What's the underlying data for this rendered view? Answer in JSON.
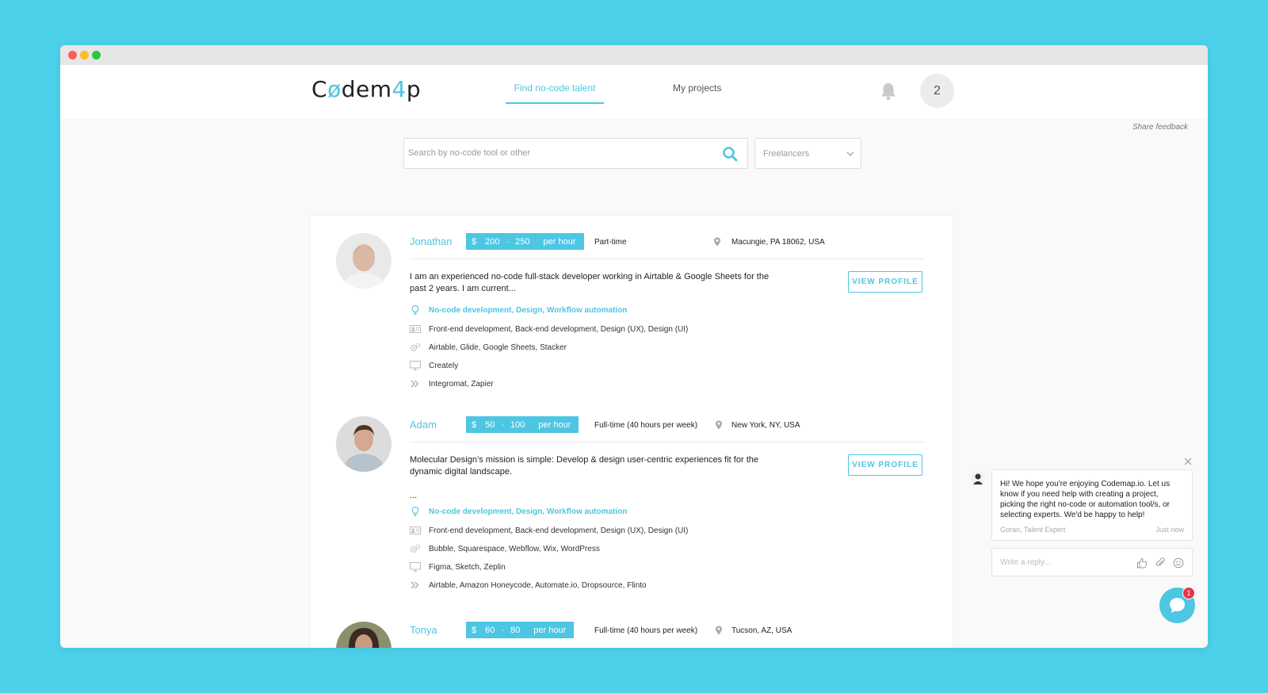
{
  "app": {
    "logo": {
      "prefix": "C",
      "o": "ø",
      "mid": "dem",
      "four": "4",
      "suffix": "p"
    },
    "nav": {
      "find_talent": "Find no-code talent",
      "my_projects": "My projects"
    },
    "user_badge": "2",
    "accent_color": "#4dc6e3"
  },
  "share_feedback": "Share feedback",
  "search": {
    "placeholder": "Search by no-code tool or other"
  },
  "filter": {
    "selected": "Freelancers"
  },
  "view_profile_label": "VIEW PROFILE",
  "freelancers": [
    {
      "name": "Jonathan",
      "rate": {
        "currency": "$",
        "min": "200",
        "sep": "-",
        "max": "250",
        "unit": "per hour"
      },
      "availability": "Part-time",
      "location": "Macungie, PA 18062, USA",
      "bio": "I am an experienced no-code full-stack developer working in Airtable & Google Sheets for the past 2 years.  I am current...",
      "categories": "No-code development, Design, Workflow automation",
      "roles": "Front-end development, Back-end development, Design (UX), Design (UI)",
      "tools": "Airtable, Glide, Google Sheets, Stacker",
      "design_tools": "Creately",
      "automation": "Integromat, Zapier"
    },
    {
      "name": "Adam",
      "rate": {
        "currency": "$",
        "min": "50",
        "sep": "-",
        "max": "100",
        "unit": "per hour"
      },
      "availability": "Full-time (40 hours per week)",
      "location": "New York, NY, USA",
      "bio": "Molecular Design’s mission is simple: Develop & design user-centric experiences fit for the dynamic digital landscape.",
      "bio_more": "...",
      "categories": "No-code development, Design, Workflow automation",
      "roles": "Front-end development, Back-end development, Design (UX), Design (UI)",
      "tools": "Bubble, Squarespace, Webflow, Wix, WordPress",
      "design_tools": "Figma, Sketch, Zeplin",
      "automation": "Airtable, Amazon Honeycode, Automate.io, Dropsource, Flinto"
    },
    {
      "name": "Tonya",
      "rate": {
        "currency": "$",
        "min": "60",
        "sep": "-",
        "max": "80",
        "unit": "per hour"
      },
      "availability": "Full-time (40 hours per week)",
      "location": "Tucson, AZ, USA"
    }
  ],
  "chat": {
    "message": "Hi! We hope you're enjoying Codemap.io. Let us know if you need help with creating a project, picking the right no-code or automation tool/s, or selecting experts. We'd be happy to help!",
    "author": "Goran, Talent Expert",
    "time": "Just now",
    "reply_placeholder": "Write a reply...",
    "unread_count": "1"
  }
}
